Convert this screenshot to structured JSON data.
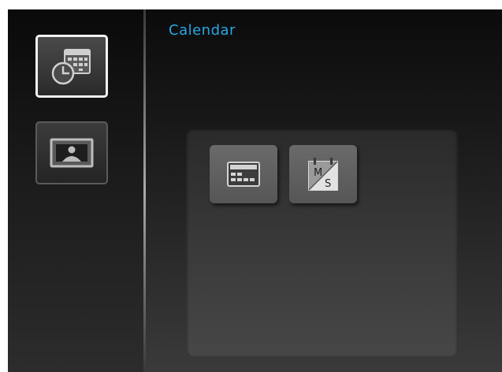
{
  "header": {
    "title": "Calendar"
  },
  "sidebar": {
    "items": [
      {
        "icon": "calendar-clock-icon",
        "state": "selected"
      },
      {
        "icon": "photo-icon",
        "state": "unselected"
      }
    ]
  },
  "panel": {
    "tiles": [
      {
        "icon": "month-calendar-icon"
      },
      {
        "icon": "calendar-ms-icon",
        "glyph_top": "M",
        "glyph_bottom": "S"
      }
    ]
  },
  "colors": {
    "title": "#2aa7e6",
    "selection_border": "#f2f2f2"
  }
}
